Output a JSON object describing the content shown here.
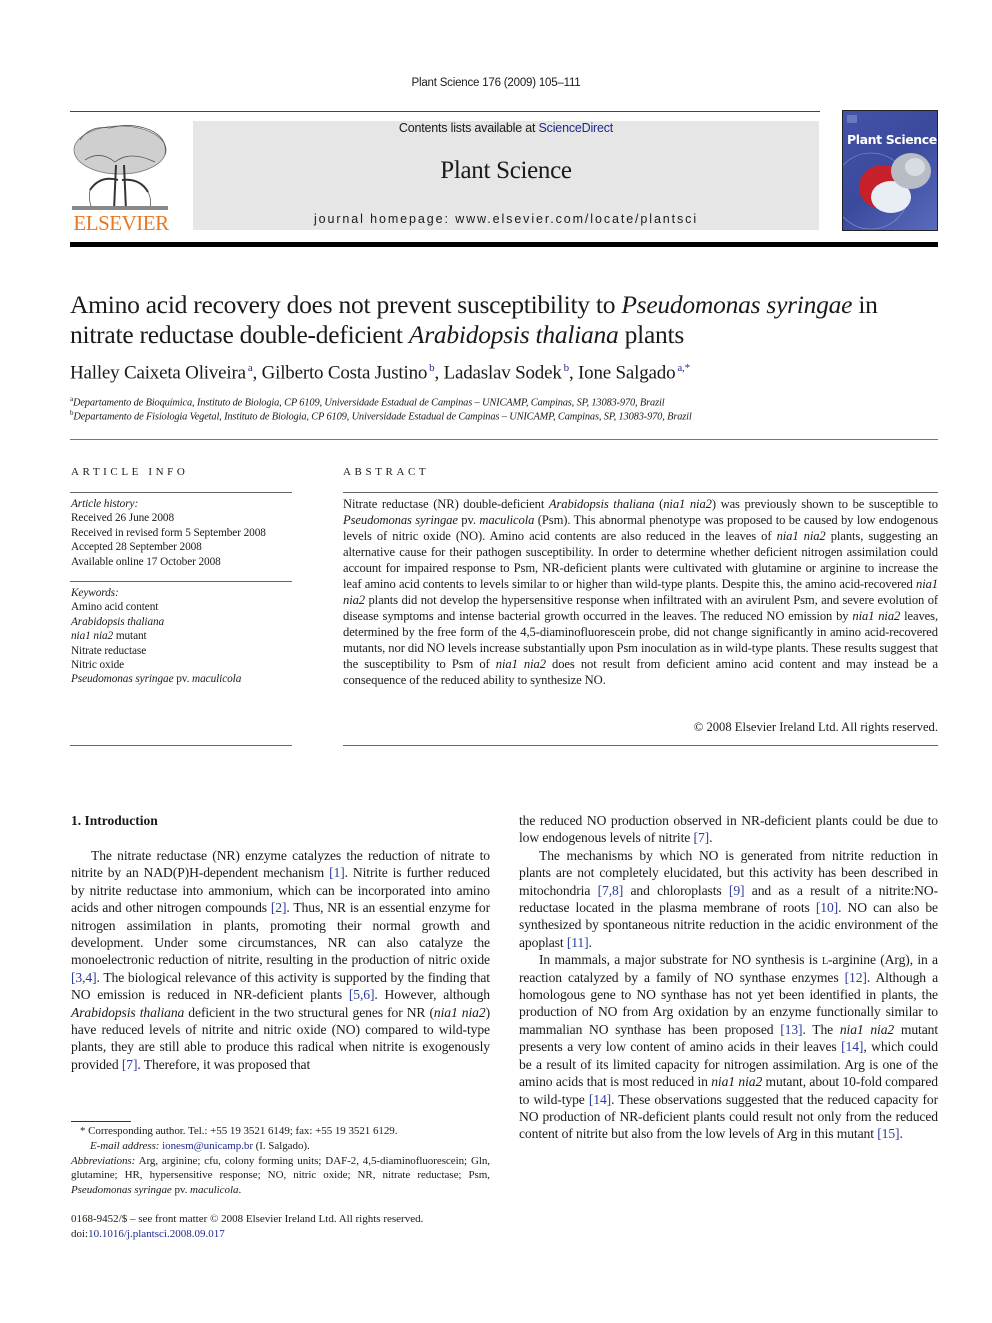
{
  "running_head": "Plant Science 176 (2009) 105–111",
  "masthead": {
    "publisher_logo_text": "ELSEVIER",
    "contents_prefix": "Contents lists available at ",
    "contents_link": "ScienceDirect",
    "journal_title": "Plant Science",
    "homepage": "journal homepage: www.elsevier.com/locate/plantsci",
    "cover_title": "Plant Science",
    "colors": {
      "elsevier_orange": "#e87722",
      "link_blue": "#1f2a8a",
      "masthead_gray": "#e6e6e6",
      "cover_blue": "#4452a8"
    }
  },
  "article": {
    "title_parts": [
      {
        "text": "Amino acid recovery does not prevent susceptibility to ",
        "italic": false
      },
      {
        "text": "Pseudomonas syringae",
        "italic": true
      },
      {
        "text": " in nitrate reductase double-deficient ",
        "italic": false
      },
      {
        "text": "Arabidopsis thaliana",
        "italic": true
      },
      {
        "text": " plants",
        "italic": false
      }
    ],
    "authors": [
      {
        "name": "Halley Caixeta Oliveira",
        "aff": "a"
      },
      {
        "name": "Gilberto Costa Justino",
        "aff": "b"
      },
      {
        "name": "Ladaslav Sodek",
        "aff": "b"
      },
      {
        "name": "Ione Salgado",
        "aff": "a,*"
      }
    ],
    "affiliations": [
      {
        "key": "a",
        "text": "Departamento de Bioquímica, Instituto de Biologia, CP 6109, Universidade Estadual de Campinas – UNICAMP, Campinas, SP, 13083-970, Brazil"
      },
      {
        "key": "b",
        "text": "Departamento de Fisiologia Vegetal, Instituto de Biologia, CP 6109, Universidade Estadual de Campinas – UNICAMP, Campinas, SP, 13083-970, Brazil"
      }
    ]
  },
  "article_info": {
    "label": "ARTICLE INFO",
    "history_label": "Article history:",
    "history": [
      "Received 26 June 2008",
      "Received in revised form 5 September 2008",
      "Accepted 28 September 2008",
      "Available online 17 October 2008"
    ],
    "keywords_label": "Keywords:",
    "keywords": [
      {
        "text": "Amino acid content",
        "italic": false
      },
      {
        "text": "Arabidopsis thaliana",
        "italic": true
      },
      {
        "text": "nia1 nia2",
        "italic": true,
        "suffix": " mutant"
      },
      {
        "text": "Nitrate reductase",
        "italic": false
      },
      {
        "text": "Nitric oxide",
        "italic": false
      },
      {
        "text": "Pseudomonas syringae",
        "italic": true,
        "suffix": " pv. ",
        "suffix_italic": "maculicola"
      }
    ]
  },
  "abstract": {
    "label": "ABSTRACT",
    "html": "Nitrate reductase (NR) double-deficient <i>Arabidopsis thaliana</i> (<i>nia1 nia2</i>) was previously shown to be susceptible to <i>Pseudomonas syringae</i> pv. <i>maculicola</i> (Psm). This abnormal phenotype was proposed to be caused by low endogenous levels of nitric oxide (NO). Amino acid contents are also reduced in the leaves of <i>nia1 nia2</i> plants, suggesting an alternative cause for their pathogen susceptibility. In order to determine whether deficient nitrogen assimilation could account for impaired response to Psm, NR-deficient plants were cultivated with glutamine or arginine to increase the leaf amino acid contents to levels similar to or higher than wild-type plants. Despite this, the amino acid-recovered <i>nia1 nia2</i> plants did not develop the hypersensitive response when infiltrated with an avirulent Psm, and severe evolution of disease symptoms and intense bacterial growth occurred in the leaves. The reduced NO emission by <i>nia1 nia2</i> leaves, determined by the free form of the 4,5-diaminofluorescein probe, did not change significantly in amino acid-recovered mutants, nor did NO levels increase substantially upon Psm inoculation as in wild-type plants. These results suggest that the susceptibility to Psm of <i>nia1 nia2</i> does not result from deficient amino acid content and may instead be a consequence of the reduced ability to synthesize NO.",
    "copyright": "© 2008 Elsevier Ireland Ltd. All rights reserved."
  },
  "introduction": {
    "heading": "1.  Introduction",
    "left_html": "The nitrate reductase (NR) enzyme catalyzes the reduction of nitrate to nitrite by an NAD(P)H-dependent mechanism <span class=\"cite\">[1]</span>. Nitrite is further reduced by nitrite reductase into ammonium, which can be incorporated into amino acids and other nitrogen compounds <span class=\"cite\">[2]</span>. Thus, NR is an essential enzyme for nitrogen assimilation in plants, promoting their normal growth and development. Under some circumstances, NR can also catalyze the monoelectronic reduction of nitrite, resulting in the production of nitric oxide <span class=\"cite\">[3,4]</span>. The biological relevance of this activity is supported by the finding that NO emission is reduced in NR-deficient plants <span class=\"cite\">[5,6]</span>. However, although <i>Arabidopsis thaliana</i> deficient in the two structural genes for NR (<i>nia1 nia2</i>) have reduced levels of nitrite and nitric oxide (NO) compared to wild-type plants, they are still able to produce this radical when nitrite is exogenously provided <span class=\"cite\">[7]</span>. Therefore, it was proposed that",
    "right_paragraphs_html": [
      "the reduced NO production observed in NR-deficient plants could be due to low endogenous levels of nitrite <span class=\"cite\">[7]</span>.",
      "The mechanisms by which NO is generated from nitrite reduction in plants are not completely elucidated, but this activity has been described in mitochondria <span class=\"cite\">[7,8]</span> and chloroplasts <span class=\"cite\">[9]</span> and as a result of a nitrite:NO-reductase located in the plasma membrane of roots <span class=\"cite\">[10]</span>. NO can also be synthesized by spontaneous nitrite reduction in the acidic environment of the apoplast <span class=\"cite\">[11]</span>.",
      "In mammals, a major substrate for NO synthesis is <span style=\"font-variant:small-caps\">l</span>-arginine (Arg), in a reaction catalyzed by a family of NO synthase enzymes <span class=\"cite\">[12]</span>. Although a homologous gene to NO synthase has not yet been identified in plants, the production of NO from Arg oxidation by an enzyme functionally similar to mammalian NO synthase has been proposed <span class=\"cite\">[13]</span>. The <i>nia1 nia2</i> mutant presents a very low content of amino acids in their leaves <span class=\"cite\">[14]</span>, which could be a result of its limited capacity for nitrogen assimilation. Arg is one of the amino acids that is most reduced in <i>nia1 nia2</i> mutant, about 10-fold compared to wild-type <span class=\"cite\">[14]</span>. These observations suggested that the reduced capacity for NO production of NR-deficient plants could result not only from the reduced content of nitrite but also from the low levels of Arg in this mutant <span class=\"cite\">[15]</span>."
    ]
  },
  "footnotes": {
    "corresponding": "* Corresponding author. Tel.: +55 19 3521 6149; fax: +55 19 3521 6129.",
    "email_label": "E-mail address:",
    "email": "ionesm@unicamp.br",
    "email_suffix": " (I. Salgado).",
    "abbrev_label": "Abbreviations:",
    "abbrev_html": " Arg, arginine; cfu, colony forming units; DAF-2, 4,5-diaminofluorescein; Gln, glutamine; HR, hypersensitive response; NO, nitric oxide; NR, nitrate reductase; Psm, <i>Pseudomonas syringae</i> pv. <i>maculicola</i>.",
    "issn": "0168-9452/$ – see front matter © 2008 Elsevier Ireland Ltd. All rights reserved.",
    "doi_prefix": "doi:",
    "doi": "10.1016/j.plantsci.2008.09.017"
  }
}
